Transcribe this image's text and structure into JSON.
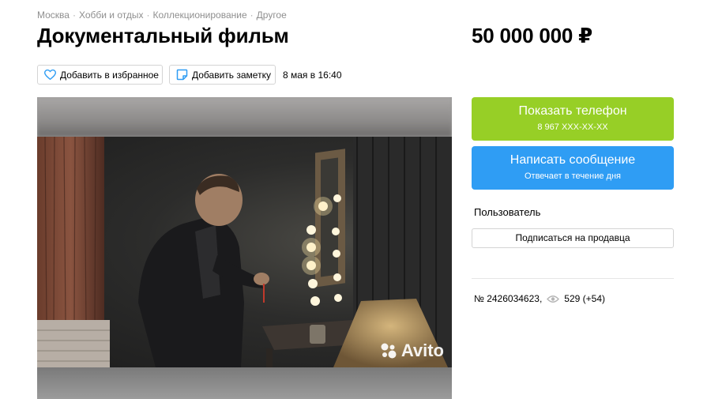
{
  "breadcrumbs": [
    "Москва",
    "Хобби и отдых",
    "Коллекционирование",
    "Другое"
  ],
  "breadcrumb_separator": "·",
  "title": "Документальный фильм",
  "price": "50 000 000 ₽",
  "actions": {
    "favorite_label": "Добавить в избранное",
    "note_label": "Добавить заметку",
    "date": "8 мая в 16:40"
  },
  "photo": {
    "watermark": "Avito"
  },
  "contact": {
    "phone_label": "Показать телефон",
    "phone_masked": "8 967 XXX-XX-XX",
    "message_label": "Написать сообщение",
    "message_sub": "Отвечает в течение дня"
  },
  "seller": {
    "name": "Пользователь",
    "subscribe_label": "Подписаться на продавца"
  },
  "listing": {
    "id": "№ 2426034623,",
    "views": "529 (+54)"
  },
  "colors": {
    "phone_button": "#97cf26",
    "message_button": "#2f9df4",
    "favorite_icon": "#2f9df4",
    "note_icon": "#2f9df4"
  }
}
